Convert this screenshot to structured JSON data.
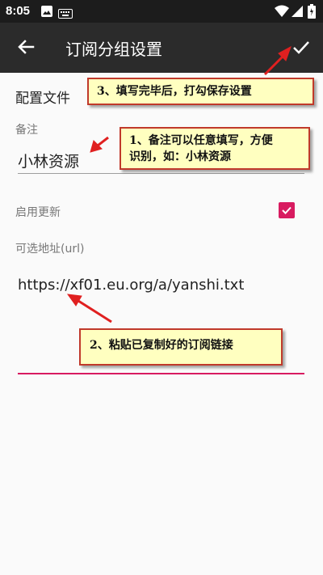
{
  "status_bar": {
    "time": "8:05",
    "icons": [
      "image-icon",
      "keyboard-icon",
      "wifi-icon",
      "signal-icon",
      "battery-icon"
    ]
  },
  "toolbar": {
    "title": "订阅分组设置",
    "back_icon": "arrow-left-icon",
    "save_icon": "check-icon"
  },
  "form": {
    "section_title": "配置文件",
    "remark_label": "备注",
    "remark_value": "小林资源",
    "enable_update_label": "启用更新",
    "enable_update_checked": true,
    "url_label": "可选地址(url)",
    "url_value": "https://xf01.eu.org/a/yanshi.txt"
  },
  "annotations": {
    "step3": "3、填写完毕后，打勾保存设置",
    "step1_line1": "1、备注可以任意填写，方便",
    "step1_line2": "识别，如：小林资源",
    "step2": "2、粘贴已复制好的订阅链接"
  },
  "colors": {
    "accent": "#d81b60",
    "toolbar": "#2b2b2b",
    "status_bar": "#1c1c1c",
    "callout_bg": "#ffffc0",
    "callout_border": "#c0392b",
    "arrow": "#e02020"
  }
}
